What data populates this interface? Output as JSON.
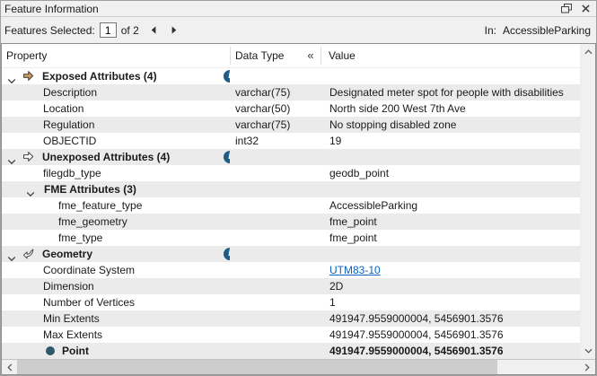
{
  "panel": {
    "title": "Feature Information"
  },
  "toolbar": {
    "features_selected_label": "Features Selected:",
    "selected_index": "1",
    "of_label": "of 2",
    "in_label": "In:",
    "in_value": "AccessibleParking"
  },
  "table": {
    "header": {
      "property": "Property",
      "data_type": "Data Type",
      "collapse_button": "«",
      "value": "Value"
    },
    "rows": [
      {
        "type": "section",
        "icon": "exposed-attributes-icon",
        "label": "Exposed Attributes (4)",
        "info": true,
        "data_type": "",
        "value": ""
      },
      {
        "type": "attr",
        "indent": 1,
        "property": "Description",
        "data_type": "varchar(75)",
        "value": "Designated meter spot for people with disabilities"
      },
      {
        "type": "attr",
        "indent": 1,
        "property": "Location",
        "data_type": "varchar(50)",
        "value": "North side 200 West 7th Ave"
      },
      {
        "type": "attr",
        "indent": 1,
        "property": "Regulation",
        "data_type": "varchar(75)",
        "value": "No stopping disabled zone"
      },
      {
        "type": "attr",
        "indent": 1,
        "property": "OBJECTID",
        "data_type": "int32",
        "value": "19"
      },
      {
        "type": "section",
        "icon": "unexposed-attributes-icon",
        "label": "Unexposed Attributes (4)",
        "info": true,
        "data_type": "",
        "value": ""
      },
      {
        "type": "attr",
        "indent": 1,
        "property": "filegdb_type",
        "data_type": "",
        "value": "geodb_point"
      },
      {
        "type": "subsection",
        "label": "FME Attributes (3)",
        "data_type": "",
        "value": ""
      },
      {
        "type": "attr",
        "indent": 2,
        "property": "fme_feature_type",
        "data_type": "",
        "value": "AccessibleParking"
      },
      {
        "type": "attr",
        "indent": 2,
        "property": "fme_geometry",
        "data_type": "",
        "value": "fme_point"
      },
      {
        "type": "attr",
        "indent": 2,
        "property": "fme_type",
        "data_type": "",
        "value": "fme_point"
      },
      {
        "type": "section",
        "icon": "geometry-icon",
        "label": "Geometry",
        "info": true,
        "data_type": "",
        "value": ""
      },
      {
        "type": "attr",
        "indent": 1,
        "property": "Coordinate System",
        "data_type": "",
        "value": "UTM83-10",
        "link": true
      },
      {
        "type": "attr",
        "indent": 1,
        "property": "Dimension",
        "data_type": "",
        "value": "2D"
      },
      {
        "type": "attr",
        "indent": 1,
        "property": "Number of Vertices",
        "data_type": "",
        "value": "1"
      },
      {
        "type": "attr",
        "indent": 1,
        "property": "Min Extents",
        "data_type": "",
        "value": "491947.9559000004, 5456901.3576"
      },
      {
        "type": "attr",
        "indent": 1,
        "property": "Max Extents",
        "data_type": "",
        "value": "491947.9559000004, 5456901.3576"
      },
      {
        "type": "point",
        "label": "Point",
        "data_type": "",
        "value": "491947.9559000004, 5456901.3576"
      }
    ]
  },
  "colors": {
    "info_icon": "#1e5c86",
    "exposed_arrow_fill": "#c69a62",
    "unexposed_arrow_fill": "#ffffff",
    "icon_stroke": "#4a4338",
    "point_bullet": "#2f5a6d",
    "link": "#0b63c5",
    "stripe": "#ebebeb"
  }
}
